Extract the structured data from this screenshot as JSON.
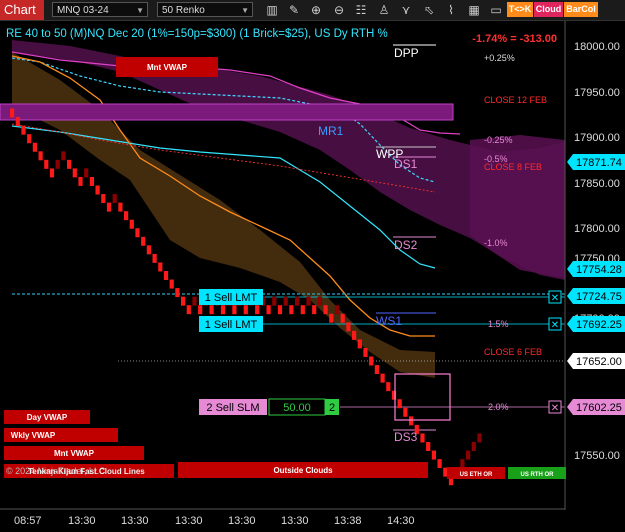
{
  "toolbar": {
    "chart_label": "Chart",
    "instrument": "MNQ 03-24",
    "bar_type": "50 Renko",
    "icons": [
      "chart-type-icon",
      "pencil-icon",
      "zoom-in-icon",
      "zoom-out-icon",
      "properties-icon",
      "strategy-icon",
      "indicators-icon",
      "cursor-icon",
      "magnet-icon",
      "chart-trader-icon"
    ],
    "tk_label": "T<>K",
    "cloud_label": "Cloud",
    "barcol_label": "BarCol"
  },
  "header": {
    "title": "RE 40 to 50 (M)NQ Dec 20 (1%=150p=$300) (1 Brick=$25), US Dy RTH %",
    "pct_change": "-1.74% = -313.00"
  },
  "levels": {
    "mnt_vwap_top": "Mnt VWAP",
    "dpp": "DPP",
    "plus_025": "+0.25%",
    "close_12feb": "CLOSE 12 FEB",
    "minus_025": "-0.25%",
    "mr1": "MR1",
    "wpp": "WPP",
    "minus_05": "-0.5%",
    "ds1": "DS1",
    "close_8feb": "CLOSE 8 FEB",
    "ds2": "DS2",
    "minus_1": "-1.0%",
    "ws1": "WS1",
    "pct_15": "1.5%",
    "close_6feb": "CLOSE 6 FEB",
    "pct_20": "2.0%",
    "ds3": "DS3"
  },
  "orders": {
    "sell_lmt_1": "1 Sell LMT",
    "sell_lmt_2": "1 Sell LMT",
    "sell_slm": "2 Sell SLM",
    "slm_qty": "50.00",
    "slm_count": "2",
    "close_x": "✕"
  },
  "prices": {
    "axis_ticks": [
      "18000.00",
      "17950.00",
      "17900.00",
      "17850.00",
      "17800.00",
      "17750.00",
      "17550.00"
    ],
    "axis_ticks_partial": "17700.00",
    "axis_tick_17650_partial": "17650.00",
    "tag_17871": "17871.74",
    "tag_17754": "17754.28",
    "tag_17724": "17724.75",
    "tag_17692": "17692.25",
    "tag_17652": "17652.00",
    "tag_17602": "17602.25"
  },
  "left_labels": {
    "day_vwap": "Day VWAP",
    "wkly_vwap": "Wkly VWAP",
    "mnt_vwap": "Mnt VWAP",
    "copyright": "© 2024 NinjaTrader, LLC",
    "overlay": "Tenkan-Kijun Fast Cloud Lines",
    "outside_clouds": "Outside Clouds",
    "us_eth": "US ETH OR",
    "us_rth": "US RTH OR"
  },
  "time_axis": [
    "08:57",
    "13:30",
    "13:30",
    "13:30",
    "13:30",
    "13:30",
    "13:38",
    "14:30"
  ],
  "colors": {
    "accent_red": "#c62828",
    "cyan": "#00e5ff",
    "pink": "#e68ad6",
    "orange": "#ff8c1a",
    "magenta_cloud": "#5a1152"
  }
}
